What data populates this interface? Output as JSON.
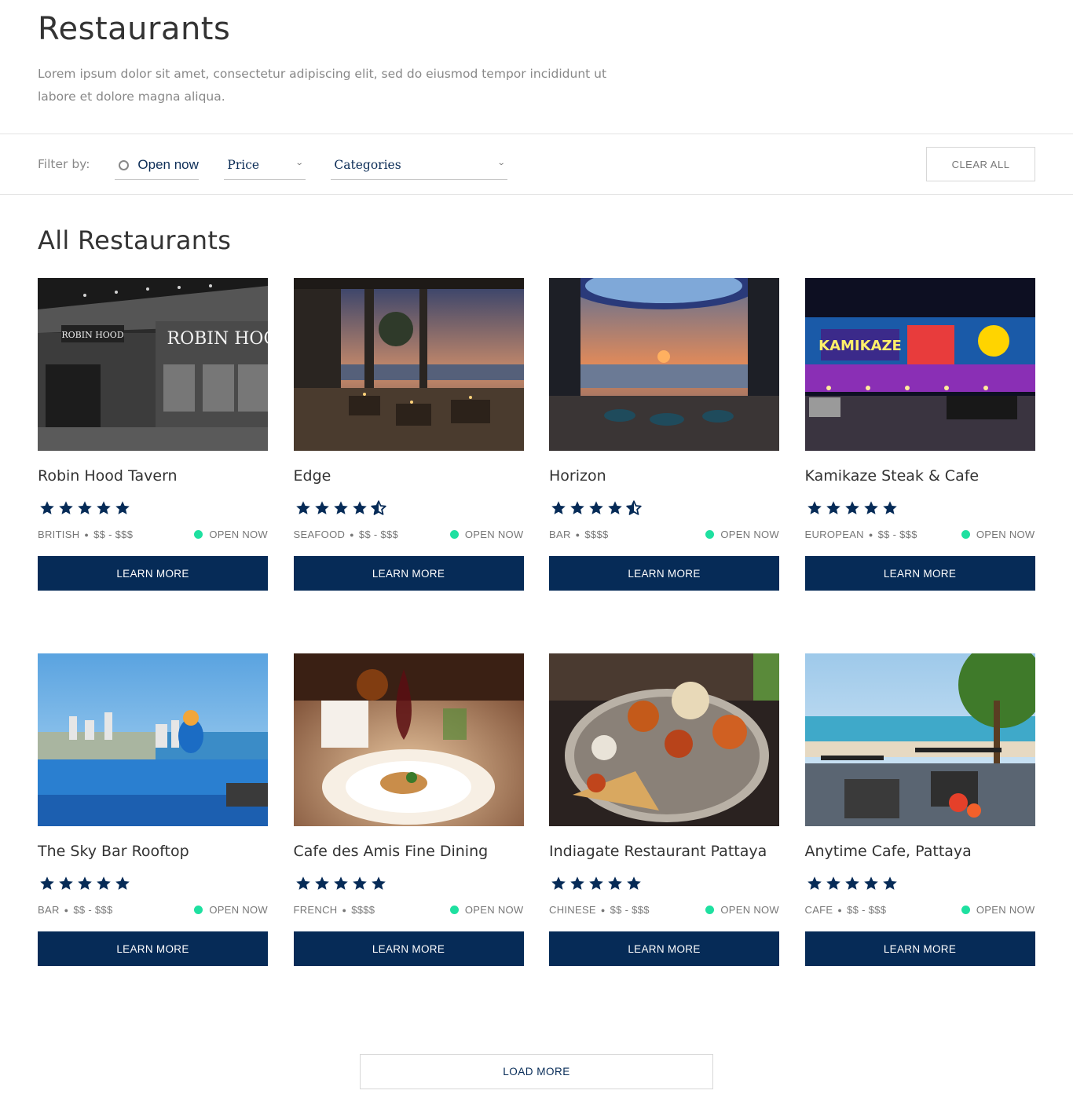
{
  "header": {
    "title": "Restaurants",
    "description": "Lorem ipsum dolor sit amet, consectetur adipiscing elit, sed do eiusmod tempor incididunt ut labore et dolore magna aliqua."
  },
  "filters": {
    "label": "Filter by:",
    "open_now_label": "Open now",
    "price_label": "Price",
    "categories_label": "Categories",
    "clear_all_label": "CLEAR ALL"
  },
  "section": {
    "title": "All Restaurants"
  },
  "colors": {
    "primary": "#062b57",
    "open_dot": "#1ee0a0",
    "star": "#062b57"
  },
  "restaurants": [
    {
      "name": "Robin Hood Tavern",
      "rating": 5,
      "category": "BRITISH",
      "price": "$$ - $$$",
      "status": "OPEN NOW",
      "cta": "LEARN MORE",
      "image": "restaurant-photo-robin-hood-tavern"
    },
    {
      "name": "Edge",
      "rating": 4.5,
      "category": "SEAFOOD",
      "price": "$$ - $$$",
      "status": "OPEN NOW",
      "cta": "LEARN MORE",
      "image": "restaurant-photo-edge"
    },
    {
      "name": "Horizon",
      "rating": 4.5,
      "category": "BAR",
      "price": "$$$$",
      "status": "OPEN NOW",
      "cta": "LEARN MORE",
      "image": "restaurant-photo-horizon"
    },
    {
      "name": "Kamikaze Steak & Cafe",
      "rating": 5,
      "category": "EUROPEAN",
      "price": "$$ - $$$",
      "status": "OPEN NOW",
      "cta": "LEARN MORE",
      "image": "restaurant-photo-kamikaze"
    },
    {
      "name": "The Sky Bar Rooftop",
      "rating": 5,
      "category": "BAR",
      "price": "$$ - $$$",
      "status": "OPEN NOW",
      "cta": "LEARN MORE",
      "image": "restaurant-photo-sky-bar"
    },
    {
      "name": "Cafe des Amis Fine Dining",
      "rating": 5,
      "category": "FRENCH",
      "price": "$$$$",
      "status": "OPEN NOW",
      "cta": "LEARN MORE",
      "image": "restaurant-photo-cafe-des-amis"
    },
    {
      "name": "Indiagate Restaurant Pattaya",
      "rating": 5,
      "category": "CHINESE",
      "price": "$$ - $$$",
      "status": "OPEN NOW",
      "cta": "LEARN MORE",
      "image": "restaurant-photo-indiagate"
    },
    {
      "name": "Anytime Cafe, Pattaya",
      "rating": 5,
      "category": "CAFE",
      "price": "$$ - $$$",
      "status": "OPEN NOW",
      "cta": "LEARN MORE",
      "image": "restaurant-photo-anytime-cafe"
    }
  ],
  "load_more_label": "LOAD MORE"
}
